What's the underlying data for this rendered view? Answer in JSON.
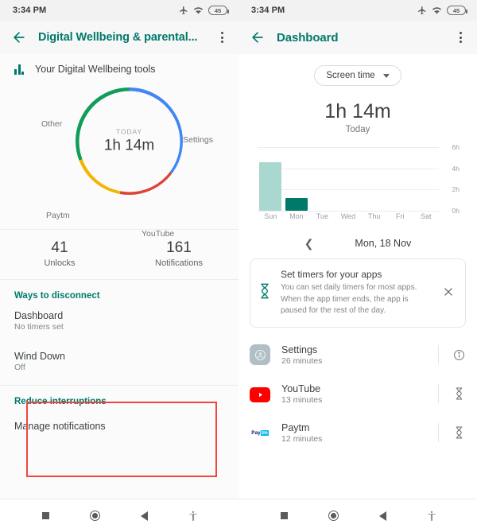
{
  "status_bar": {
    "time": "3:34 PM",
    "battery_level": "45",
    "icons": [
      "airplane-mode-icon",
      "wifi-icon",
      "battery-icon"
    ]
  },
  "left_screen": {
    "appbar": {
      "back_icon": "back-arrow-icon",
      "title": "Digital Wellbeing & parental...",
      "overflow_icon": "kebab-menu-icon"
    },
    "tools_header": "Your Digital Wellbeing tools",
    "donut": {
      "center_label": "TODAY",
      "center_value": "1h 14m",
      "labels": {
        "other": "Other",
        "settings": "Settings",
        "paytm": "Paytm",
        "youtube": "YouTube"
      }
    },
    "stats": [
      {
        "number": "41",
        "caption": "Unlocks"
      },
      {
        "number": "161",
        "caption": "Notifications"
      }
    ],
    "ways_section": {
      "heading": "Ways to disconnect",
      "items": [
        {
          "title": "Dashboard",
          "subtitle": "No timers set"
        },
        {
          "title": "Wind Down",
          "subtitle": "Off"
        }
      ]
    },
    "reduce_section": {
      "heading": "Reduce interruptions",
      "items": [
        {
          "title": "Manage notifications"
        }
      ]
    },
    "annotation": {
      "color": "#f2463c",
      "shape": "rectangle"
    }
  },
  "right_screen": {
    "appbar": {
      "back_icon": "back-arrow-icon",
      "title": "Dashboard",
      "overflow_icon": "kebab-menu-icon"
    },
    "filter_pill": {
      "label": "Screen time",
      "icon": "chevron-down-icon"
    },
    "total": "1h 14m",
    "total_sub": "Today",
    "date_nav": {
      "prev_icon": "chevron-left-icon",
      "date": "Mon, 18 Nov"
    },
    "timer_card": {
      "icon": "hourglass-icon",
      "title": "Set timers for your apps",
      "description": "You can set daily timers for most apps. When the app timer ends, the app is paused for the rest of the day.",
      "close_icon": "close-icon"
    },
    "apps": [
      {
        "icon": "settings-app-icon",
        "name": "Settings",
        "time": "26 minutes",
        "trailing_icon": "info-icon"
      },
      {
        "icon": "youtube-app-icon",
        "name": "YouTube",
        "time": "13 minutes",
        "trailing_icon": "hourglass-icon"
      },
      {
        "icon": "paytm-app-icon",
        "name": "Paytm",
        "time": "12 minutes",
        "trailing_icon": "hourglass-icon"
      }
    ]
  },
  "nav_bar": {
    "buttons": [
      "recents-square-icon",
      "home-circle-icon",
      "back-triangle-icon",
      "accessibility-icon"
    ]
  },
  "chart_data": [
    {
      "type": "pie",
      "title": "Today screen time breakdown",
      "center_label": "TODAY",
      "center_value": "1h 14m",
      "categories": [
        "Settings",
        "YouTube",
        "Paytm",
        "Other"
      ],
      "values": [
        26,
        13,
        12,
        23
      ],
      "unit": "minutes",
      "colors": [
        "#4285f4",
        "#db4437",
        "#f4b400",
        "#0f9d58"
      ],
      "legend": "labels around donut",
      "donut": true
    },
    {
      "type": "bar",
      "title": "Screen time this week",
      "categories": [
        "Sun",
        "Mon",
        "Tue",
        "Wed",
        "Thu",
        "Fri",
        "Sat"
      ],
      "values": [
        4.6,
        1.23,
        0,
        0,
        0,
        0,
        0
      ],
      "xlabel": "",
      "ylabel": "hours",
      "ylim": [
        0,
        6
      ],
      "yticks": [
        "0h",
        "2h",
        "4h",
        "6h"
      ],
      "grid": true,
      "legend": "none",
      "bar_colors": [
        "#a8d8d0",
        "#00796b",
        "#a8d8d0",
        "#a8d8d0",
        "#a8d8d0",
        "#a8d8d0",
        "#a8d8d0"
      ],
      "highlight_index": 1
    }
  ]
}
